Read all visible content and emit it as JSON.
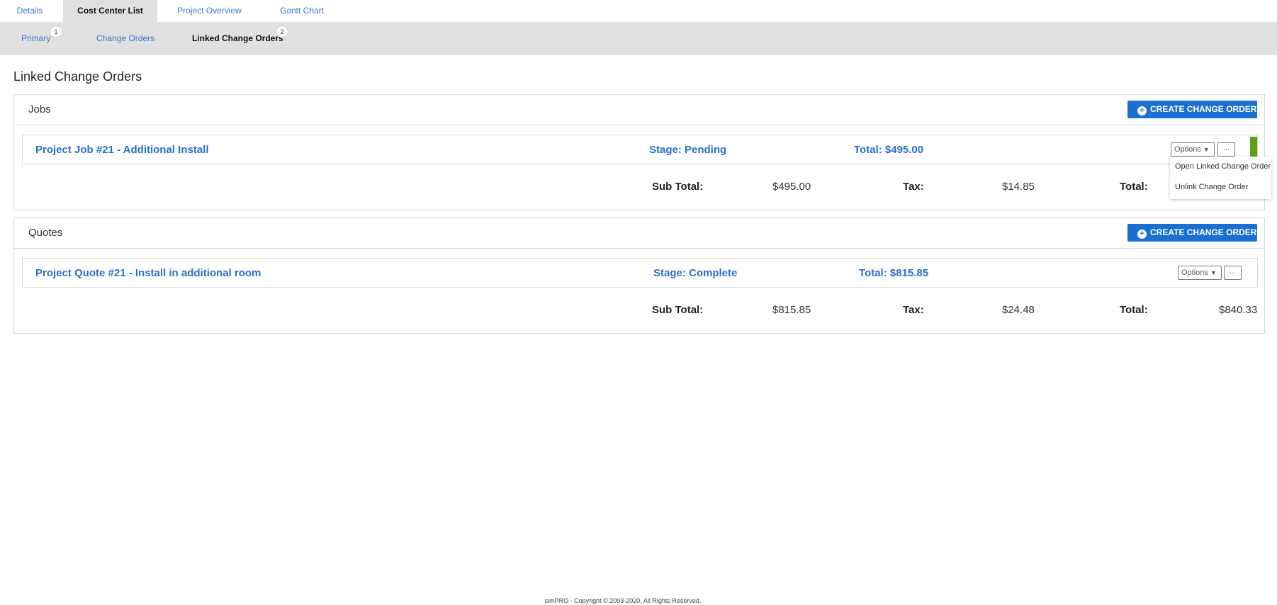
{
  "top_tabs": [
    "Details",
    "Cost Center List",
    "Project Overview",
    "Gantt Chart"
  ],
  "sub_tabs": {
    "primary": {
      "label": "Primary",
      "count": "1"
    },
    "change_orders": {
      "label": "Change Orders"
    },
    "linked": {
      "label": "Linked Change Orders",
      "count": "2"
    }
  },
  "page_title": "Linked Change Orders",
  "create_label": "CREATE CHANGE ORDER",
  "jobs": {
    "title": "Jobs",
    "item": {
      "title": "Project Job #21 - Additional Install",
      "stage": "Stage: Pending",
      "total": "Total: $495.00",
      "options": "Options",
      "more": "..."
    },
    "summary": {
      "subtotal_label": "Sub Total:",
      "subtotal": "$495.00",
      "tax_label": "Tax:",
      "tax": "$14.85",
      "total_label": "Total:"
    }
  },
  "quotes": {
    "title": "Quotes",
    "item": {
      "title": "Project Quote #21 - Install in additional room",
      "stage": "Stage: Complete",
      "total": "Total: $815.85",
      "options": "Options",
      "more": "..."
    },
    "summary": {
      "subtotal_label": "Sub Total:",
      "subtotal": "$815.85",
      "tax_label": "Tax:",
      "tax": "$24.48",
      "total_label": "Total:",
      "total": "$840.33"
    }
  },
  "dropdown": [
    "Open Linked Change Order",
    "Unlink Change Order"
  ],
  "footer": "simPRO - Copyright © 2003-2020, All Rights Reserved.",
  "colors": {
    "link": "#2a6fc9",
    "button": "#1a6fd0",
    "status_green": "#5ea012"
  },
  "icons": {
    "create": "plus-circle-icon",
    "options_caret": "caret-down-icon"
  }
}
